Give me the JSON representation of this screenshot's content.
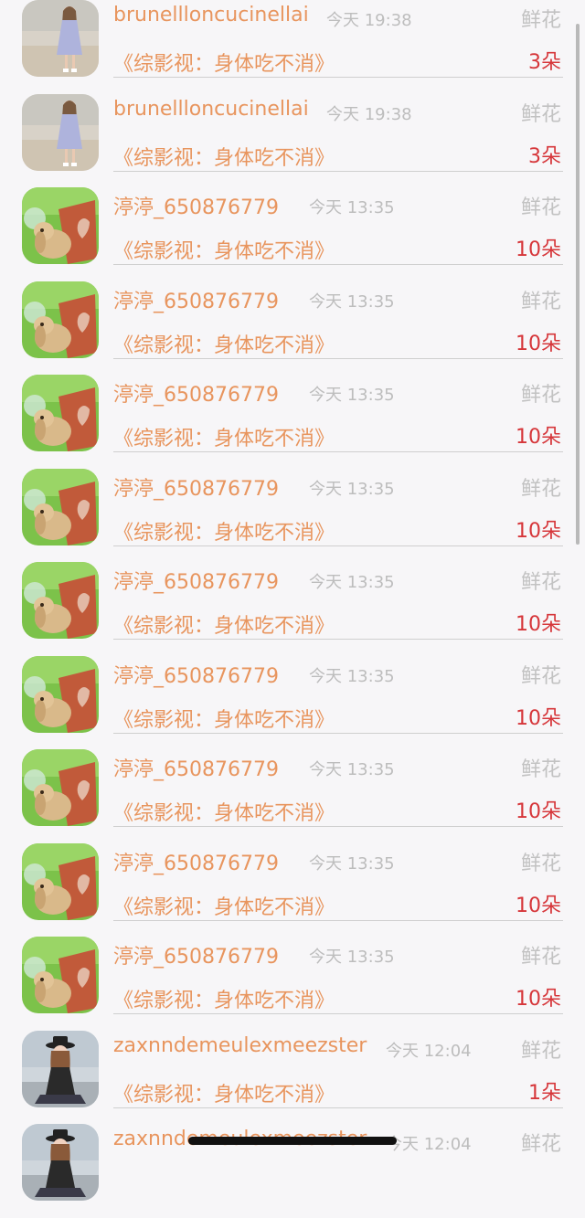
{
  "items": [
    {
      "avatar": "girl-dress-avatar",
      "name": "brunellloncucinellai",
      "time": "今天 19:38",
      "type": "鲜花",
      "title": "《综影视：身体吃不消》",
      "count": "3朵"
    },
    {
      "avatar": "girl-dress-avatar",
      "name": "brunellloncucinellai",
      "time": "今天 19:38",
      "type": "鲜花",
      "title": "《综影视：身体吃不消》",
      "count": "3朵"
    },
    {
      "avatar": "bunny-pot-avatar",
      "name": "渟渟_650876779",
      "time": "今天 13:35",
      "type": "鲜花",
      "title": "《综影视：身体吃不消》",
      "count": "10朵"
    },
    {
      "avatar": "bunny-pot-avatar",
      "name": "渟渟_650876779",
      "time": "今天 13:35",
      "type": "鲜花",
      "title": "《综影视：身体吃不消》",
      "count": "10朵"
    },
    {
      "avatar": "bunny-pot-avatar",
      "name": "渟渟_650876779",
      "time": "今天 13:35",
      "type": "鲜花",
      "title": "《综影视：身体吃不消》",
      "count": "10朵"
    },
    {
      "avatar": "bunny-pot-avatar",
      "name": "渟渟_650876779",
      "time": "今天 13:35",
      "type": "鲜花",
      "title": "《综影视：身体吃不消》",
      "count": "10朵"
    },
    {
      "avatar": "bunny-pot-avatar",
      "name": "渟渟_650876779",
      "time": "今天 13:35",
      "type": "鲜花",
      "title": "《综影视：身体吃不消》",
      "count": "10朵"
    },
    {
      "avatar": "bunny-pot-avatar",
      "name": "渟渟_650876779",
      "time": "今天 13:35",
      "type": "鲜花",
      "title": "《综影视：身体吃不消》",
      "count": "10朵"
    },
    {
      "avatar": "bunny-pot-avatar",
      "name": "渟渟_650876779",
      "time": "今天 13:35",
      "type": "鲜花",
      "title": "《综影视：身体吃不消》",
      "count": "10朵"
    },
    {
      "avatar": "bunny-pot-avatar",
      "name": "渟渟_650876779",
      "time": "今天 13:35",
      "type": "鲜花",
      "title": "《综影视：身体吃不消》",
      "count": "10朵"
    },
    {
      "avatar": "bunny-pot-avatar",
      "name": "渟渟_650876779",
      "time": "今天 13:35",
      "type": "鲜花",
      "title": "《综影视：身体吃不消》",
      "count": "10朵"
    },
    {
      "avatar": "girl-hat-avatar",
      "name": "zaxnndemeulexmeezster",
      "time": "今天 12:04",
      "type": "鲜花",
      "title": "《综影视：身体吃不消》",
      "count": "1朵"
    },
    {
      "avatar": "girl-hat-avatar",
      "name": "zaxnndemeulexmeezster",
      "time": "今天 12:04",
      "type": "鲜花",
      "title": "",
      "count": ""
    }
  ],
  "colors": {
    "name": "#e8955e",
    "title": "#e8955e",
    "count": "#d6363a",
    "meta": "#c2c2c2",
    "background": "#f7f6f8"
  }
}
